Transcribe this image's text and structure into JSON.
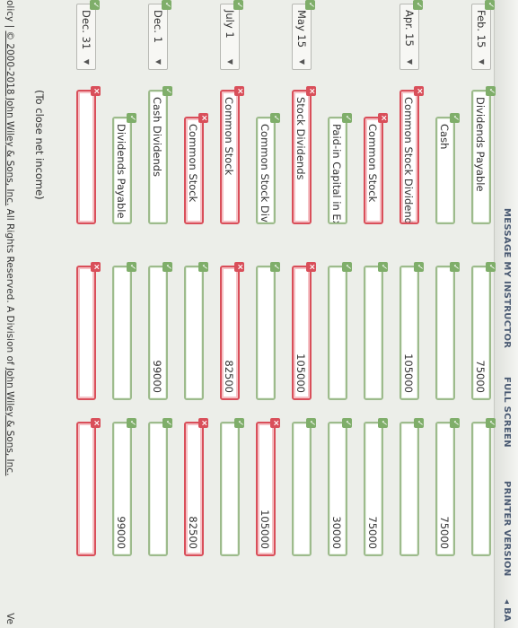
{
  "toolbar": {
    "message": "MESSAGE MY INSTRUCTOR",
    "fullscreen": "FULL SCREEN",
    "printer": "PRINTER VERSION",
    "back": "◂ BA"
  },
  "entries": [
    {
      "date": "Feb. 15",
      "account": "Dividends Payable",
      "debit": "75000",
      "credit": "",
      "account_ok": true,
      "debit_ok": true,
      "credit_ok": true
    },
    {
      "date": "",
      "account": "Cash",
      "debit": "",
      "credit": "75000",
      "account_ok": true,
      "debit_ok": true,
      "credit_ok": true
    },
    {
      "date": "Apr. 15",
      "account": "Common Stock Dividends",
      "debit": "105000",
      "credit": "",
      "account_ok": false,
      "debit_ok": true,
      "credit_ok": true
    },
    {
      "date": "",
      "account": "Common Stock",
      "debit": "",
      "credit": "75000",
      "account_ok": false,
      "debit_ok": true,
      "credit_ok": true
    },
    {
      "date": "",
      "account": "Paid-in Capital in Exces",
      "debit": "",
      "credit": "30000",
      "account_ok": true,
      "debit_ok": true,
      "credit_ok": true
    },
    {
      "date": "May 15",
      "account": "Stock Dividends",
      "debit": "105000",
      "credit": "",
      "account_ok": false,
      "debit_ok": false,
      "credit_ok": true
    },
    {
      "date": "",
      "account": "Common Stock Dividen",
      "debit": "",
      "credit": "105000",
      "account_ok": true,
      "debit_ok": true,
      "credit_ok": false
    },
    {
      "date": "July 1",
      "account": "Common Stock",
      "debit": "82500",
      "credit": "",
      "account_ok": false,
      "debit_ok": false,
      "credit_ok": true
    },
    {
      "date": "",
      "account": "Common Stock",
      "debit": "",
      "credit": "82500",
      "account_ok": false,
      "debit_ok": true,
      "credit_ok": false
    },
    {
      "date": "Dec. 1",
      "account": "Cash Dividends",
      "debit": "99000",
      "credit": "",
      "account_ok": true,
      "debit_ok": true,
      "credit_ok": true
    },
    {
      "date": "",
      "account": "Dividends Payable",
      "debit": "",
      "credit": "99000",
      "account_ok": true,
      "debit_ok": true,
      "credit_ok": true
    },
    {
      "date": "Dec. 31",
      "account": "",
      "debit": "",
      "credit": "",
      "account_ok": false,
      "debit_ok": false,
      "credit_ok": false
    }
  ],
  "note": "(To close net income)",
  "footer": {
    "prefix": "olicy  |  ",
    "copyright": "© 2000-2018 John Wiley & Sons, Inc.",
    "rights": " All Rights Reserved. A Division of ",
    "company": "John Wiley & Sons, Inc.",
    "right_text": "Ve"
  }
}
